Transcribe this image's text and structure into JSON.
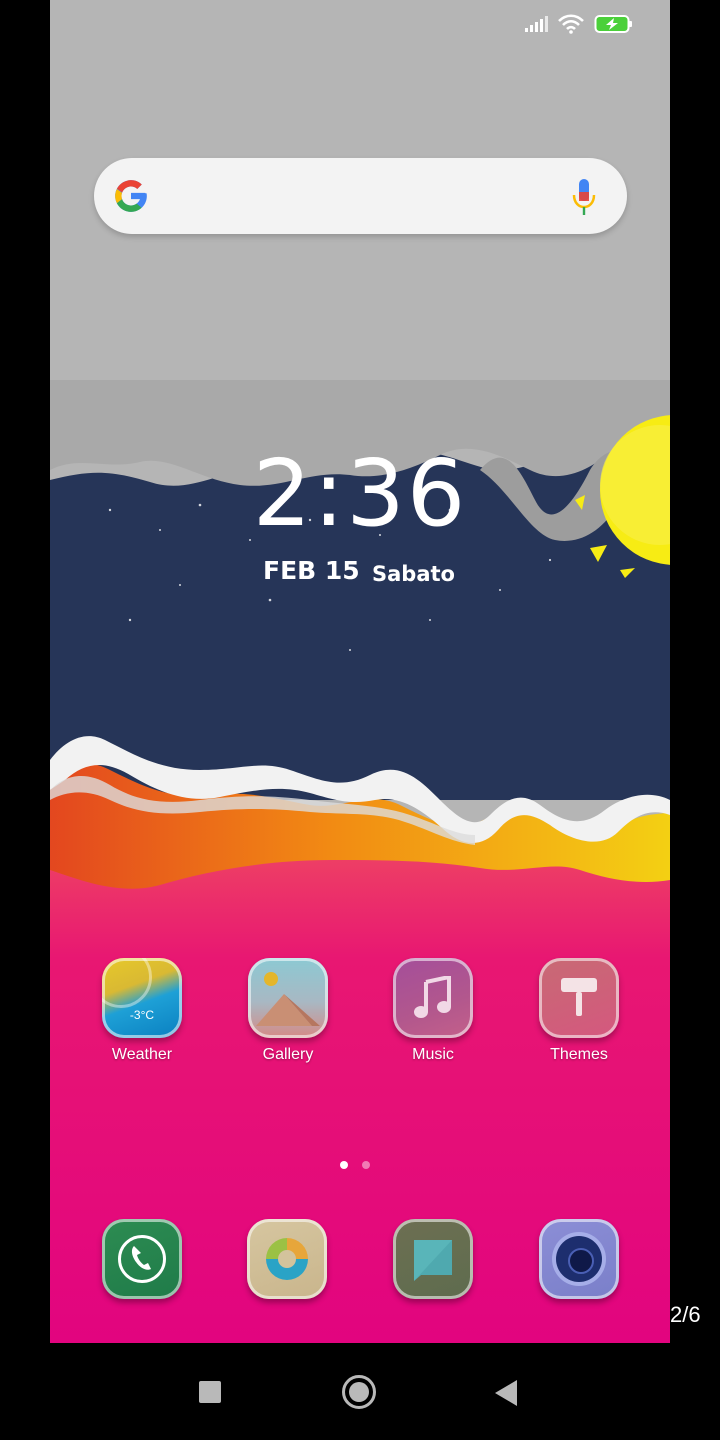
{
  "status_bar": {
    "icons": [
      "signal-icon",
      "wifi-icon",
      "battery-charging-icon"
    ],
    "battery_color": "#4bd03a"
  },
  "search": {
    "logo": "google-icon",
    "mic": "microphone-icon"
  },
  "clock": {
    "time": "2:36",
    "date": "FEB 15",
    "day": "Sabato"
  },
  "apps": [
    {
      "label": "Weather",
      "icon": "weather-icon",
      "temp": "-3°C"
    },
    {
      "label": "Gallery",
      "icon": "gallery-icon"
    },
    {
      "label": "Music",
      "icon": "music-icon"
    },
    {
      "label": "Themes",
      "icon": "themes-icon"
    }
  ],
  "page_indicator": {
    "pages": 2,
    "current": 1
  },
  "dock": [
    {
      "icon": "phone-icon"
    },
    {
      "icon": "browser-icon"
    },
    {
      "icon": "messages-icon"
    },
    {
      "icon": "camera-icon"
    }
  ],
  "page_counter": "2/6",
  "colors": {
    "sky": "#b5b5b5",
    "night": "#263558",
    "pink": "#e2067f",
    "orange": "#f07d1e",
    "sun": "#f7ec14"
  }
}
